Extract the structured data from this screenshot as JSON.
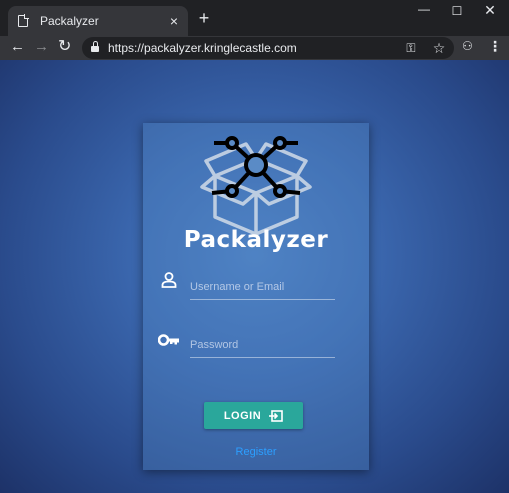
{
  "browser": {
    "tab_title": "Packalyzer",
    "tab_close": "×",
    "new_tab": "+",
    "window_controls": {
      "minimize": "—",
      "maximize": "☐",
      "close": "✕"
    },
    "url": "https://packalyzer.kringlecastle.com",
    "nav_icons": [
      "back-icon",
      "forward-icon",
      "reload-icon"
    ],
    "omnibox_icons": [
      "lock-icon",
      "key-icon",
      "star-icon"
    ],
    "toolbar_icons": [
      "extension-icon",
      "menu-icon"
    ]
  },
  "login": {
    "brand": "Packalyzer",
    "logo_icon": "package-network-icon",
    "username_placeholder": "Username or Email",
    "password_placeholder": "Password",
    "login_label": "LOGIN",
    "register_label": "Register"
  },
  "colors": {
    "background_center": "#4a7cc0",
    "background_edge": "#1d3268",
    "login_button": "#2aa79b",
    "register_link": "#2c9fff",
    "chrome_dark": "#202124",
    "chrome_toolbar": "#35363a"
  }
}
